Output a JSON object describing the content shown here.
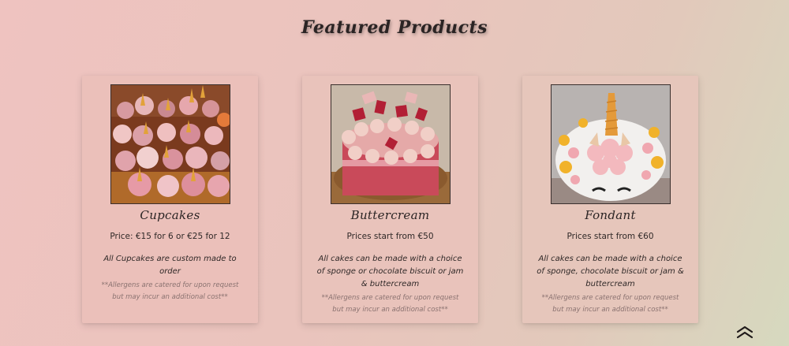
{
  "page": {
    "title": "Featured Products"
  },
  "products": [
    {
      "name": "Cupcakes",
      "price": "Price: €15 for 6 or €25 for 12",
      "description": "All Cupcakes are custom made to order",
      "note_line1": "**Allergens are catered for upon request",
      "note_line2": "but may incur an additional cost**"
    },
    {
      "name": "Buttercream",
      "price": "Prices start from €50",
      "description": "All cakes can be made with a choice of sponge or chocolate biscuit or jam & buttercream",
      "note_line1": "**Allergens are catered for upon request",
      "note_line2": "but may incur an additional cost**"
    },
    {
      "name": "Fondant",
      "price": "Prices start from €60",
      "description": "All cakes can be made with a choice of sponge, chocolate biscuit or jam & buttercream",
      "note_line1": "**Allergens are catered for upon request",
      "note_line2": "but may incur an additional cost**"
    }
  ],
  "scroll_top_icon": "double-chevron-up-icon"
}
